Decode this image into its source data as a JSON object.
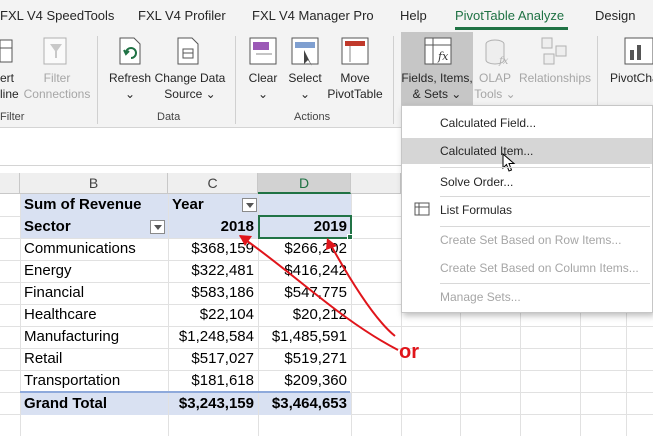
{
  "tabs": [
    {
      "label": "FXL V4 SpeedTools",
      "active": false
    },
    {
      "label": "FXL V4 Profiler",
      "active": false
    },
    {
      "label": "FXL V4 Manager Pro",
      "active": false
    },
    {
      "label": "Help",
      "active": false
    },
    {
      "label": "PivotTable Analyze",
      "active": true
    },
    {
      "label": "Design",
      "active": false
    }
  ],
  "ribbon": {
    "insert_timeline": {
      "line1": "ert",
      "line2": "line"
    },
    "filter_connections": {
      "line1": "Filter",
      "line2": "Connections"
    },
    "refresh": {
      "line1": "Refresh",
      "line2": "⌄"
    },
    "change_data_source": {
      "line1": "Change Data",
      "line2": "Source ⌄"
    },
    "clear": {
      "line1": "Clear",
      "line2": "⌄"
    },
    "select": {
      "line1": "Select",
      "line2": "⌄"
    },
    "move_pivottable": {
      "line1": "Move",
      "line2": "PivotTable"
    },
    "fields_items_sets": {
      "line1": "Fields, Items,",
      "line2": "& Sets ⌄"
    },
    "olap_tools": {
      "line1": "OLAP",
      "line2": "Tools ⌄"
    },
    "relationships": {
      "line1": "Relationships"
    },
    "pivotchart": {
      "line1": "PivotCha"
    },
    "groups": {
      "filter": "Filter",
      "data": "Data",
      "actions": "Actions"
    }
  },
  "columns": [
    "B",
    "C",
    "D"
  ],
  "pivot": {
    "title": "Sum of Revenue",
    "col_field": "Year",
    "row_field": "Sector",
    "years": [
      "2018",
      "2019"
    ],
    "rows": [
      {
        "sector": "Communications",
        "y2018": "$368,159",
        "y2019": "$266,202"
      },
      {
        "sector": "Energy",
        "y2018": "$322,481",
        "y2019": "$416,242"
      },
      {
        "sector": "Financial",
        "y2018": "$583,186",
        "y2019": "$547,775"
      },
      {
        "sector": "Healthcare",
        "y2018": "$22,104",
        "y2019": "$20,212"
      },
      {
        "sector": "Manufacturing",
        "y2018": "$1,248,584",
        "y2019": "$1,485,591"
      },
      {
        "sector": "Retail",
        "y2018": "$517,027",
        "y2019": "$519,271"
      },
      {
        "sector": "Transportation",
        "y2018": "$181,618",
        "y2019": "$209,360"
      }
    ],
    "grand_total": {
      "label": "Grand Total",
      "y2018": "$3,243,159",
      "y2019": "$3,464,653"
    }
  },
  "menu": {
    "items": [
      {
        "label": "Calculated Field...",
        "enabled": true
      },
      {
        "label": "Calculated Item...",
        "enabled": true,
        "hover": true
      },
      {
        "label": "Solve Order...",
        "enabled": true
      },
      {
        "label": "List Formulas",
        "enabled": true
      },
      {
        "label": "Create Set Based on Row Items...",
        "enabled": false
      },
      {
        "label": "Create Set Based on Column Items...",
        "enabled": false
      },
      {
        "label": "Manage Sets...",
        "enabled": false
      }
    ]
  },
  "annotation": {
    "label": "or",
    "color": "#e0151b"
  },
  "colors": {
    "accent": "#1f7244",
    "pivot_header": "#d9e1f2"
  }
}
